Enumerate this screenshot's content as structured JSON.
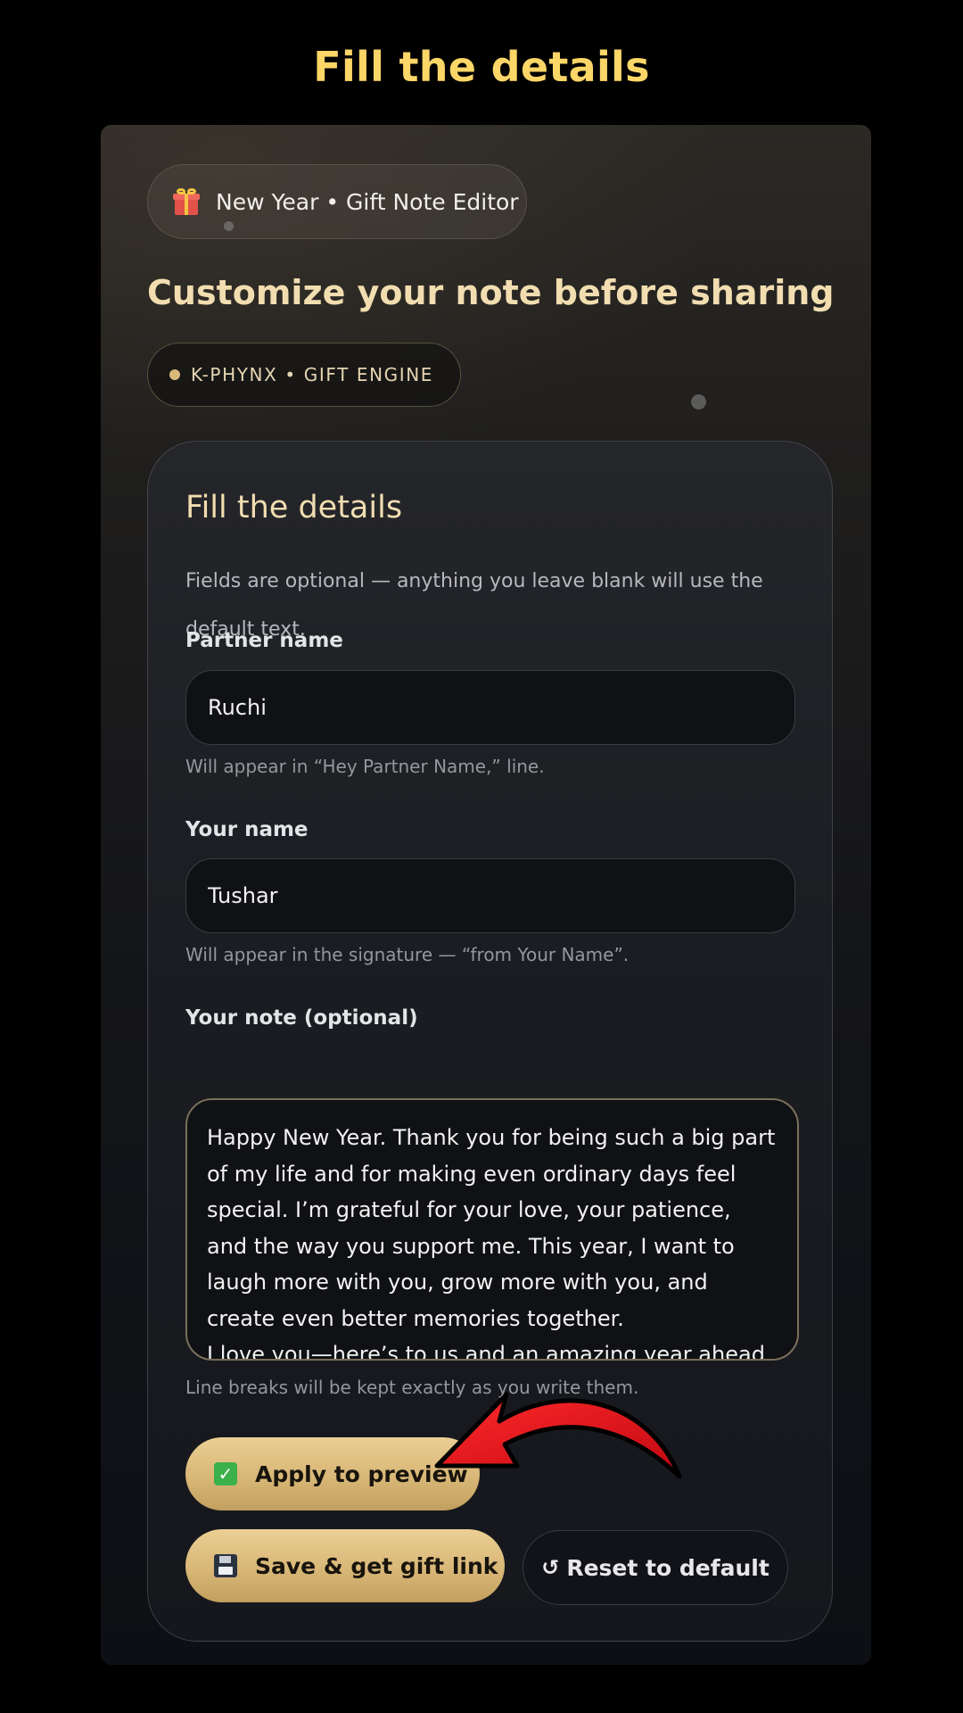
{
  "overlay": {
    "heading": "Fill the details"
  },
  "card": {
    "badge_label": "New Year • Gift Note Editor",
    "badge_icon": "gift-icon",
    "title": "Customize your note before sharing",
    "engine_label": "K-PHYNX • GIFT ENGINE"
  },
  "form": {
    "heading": "Fill the details",
    "description": "Fields are optional — anything you leave blank will use the default text.",
    "partner": {
      "label": "Partner name",
      "value": "Ruchi",
      "hint": "Will appear in “Hey Partner Name,” line."
    },
    "your_name": {
      "label": "Your name",
      "value": "Tushar",
      "hint": "Will appear in the signature — “from Your Name”."
    },
    "note": {
      "label": "Your note (optional)",
      "value": "Happy New Year. Thank you for being such a big part of my life and for making even ordinary days feel special. I’m grateful for your love, your patience, and the way you support me. This year, I want to laugh more with you, grow more with you, and create even better memories together.\nI love you—here’s to us and an amazing year ahead.",
      "hint": "Line breaks will be kept exactly as you write them."
    }
  },
  "buttons": {
    "apply": "Apply to preview",
    "apply_icon": "check-icon",
    "save": "Save & get gift link",
    "save_icon": "floppy-icon",
    "reset": "Reset to default",
    "reset_icon": "↺"
  },
  "colors": {
    "overlay_heading": "#fcd667",
    "accent_gold": "#d8b777",
    "title_gold": "#f1ddb0",
    "annotation_arrow": "#e0141e"
  }
}
